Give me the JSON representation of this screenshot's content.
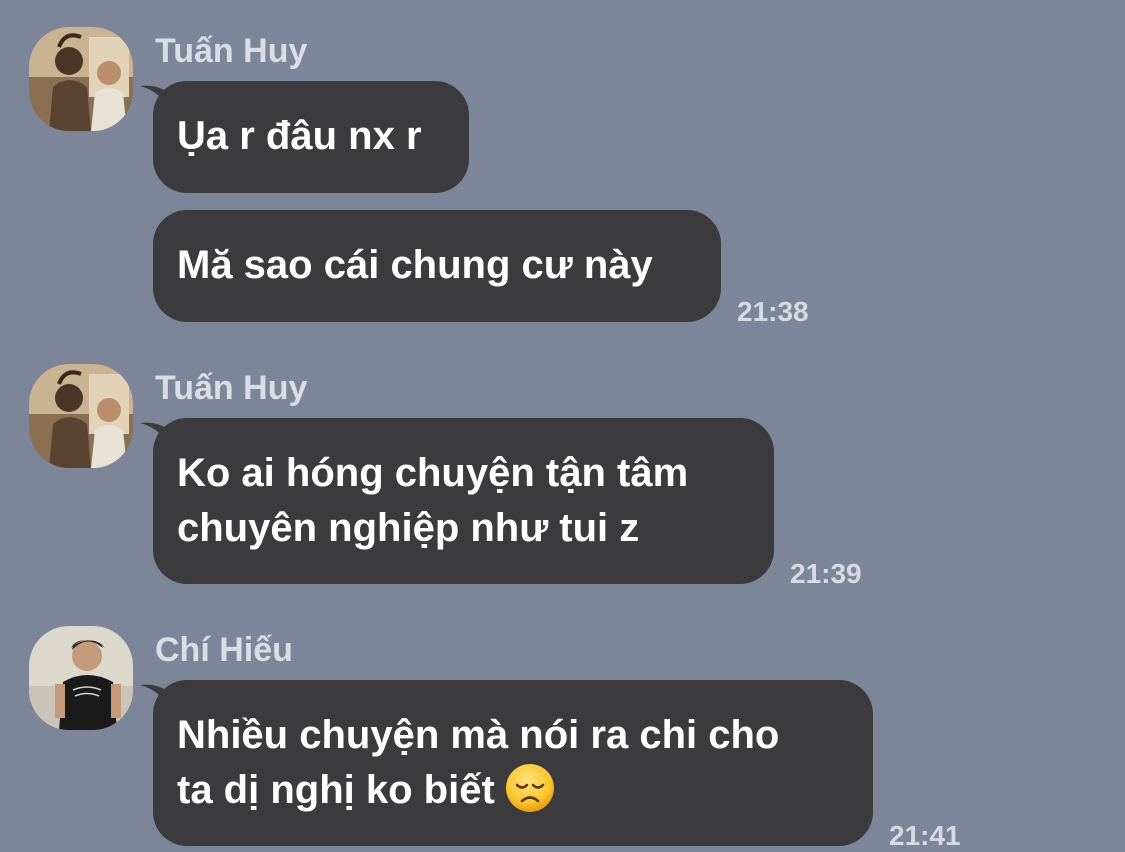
{
  "messages": [
    {
      "sender": "Tuấn Huy",
      "avatar_icon": "user-photo-avatar",
      "bubbles": [
        {
          "lines": [
            "Ụa r đâu nx r"
          ]
        },
        {
          "lines": [
            "Mă sao cái chung cư này"
          ]
        }
      ],
      "time": "21:38"
    },
    {
      "sender": "Tuấn Huy",
      "avatar_icon": "user-photo-avatar",
      "bubbles": [
        {
          "lines": [
            "Ko ai hóng chuyện tận tâm",
            "chuyên nghiệp như tui z"
          ]
        }
      ],
      "time": "21:39"
    },
    {
      "sender": "Chí Hiếu",
      "avatar_icon": "user-photo-avatar",
      "bubbles": [
        {
          "lines": [
            "Nhiều chuyện mà nói ra chi cho",
            "ta dị nghị ko biết"
          ],
          "emoji": "disappointed-face-emoji"
        }
      ],
      "time": "21:41"
    }
  ],
  "colors": {
    "background": "#7d8699",
    "bubble": "#3b3b3d",
    "bubble_text": "#ffffff",
    "meta_text": "#d6dae3"
  }
}
